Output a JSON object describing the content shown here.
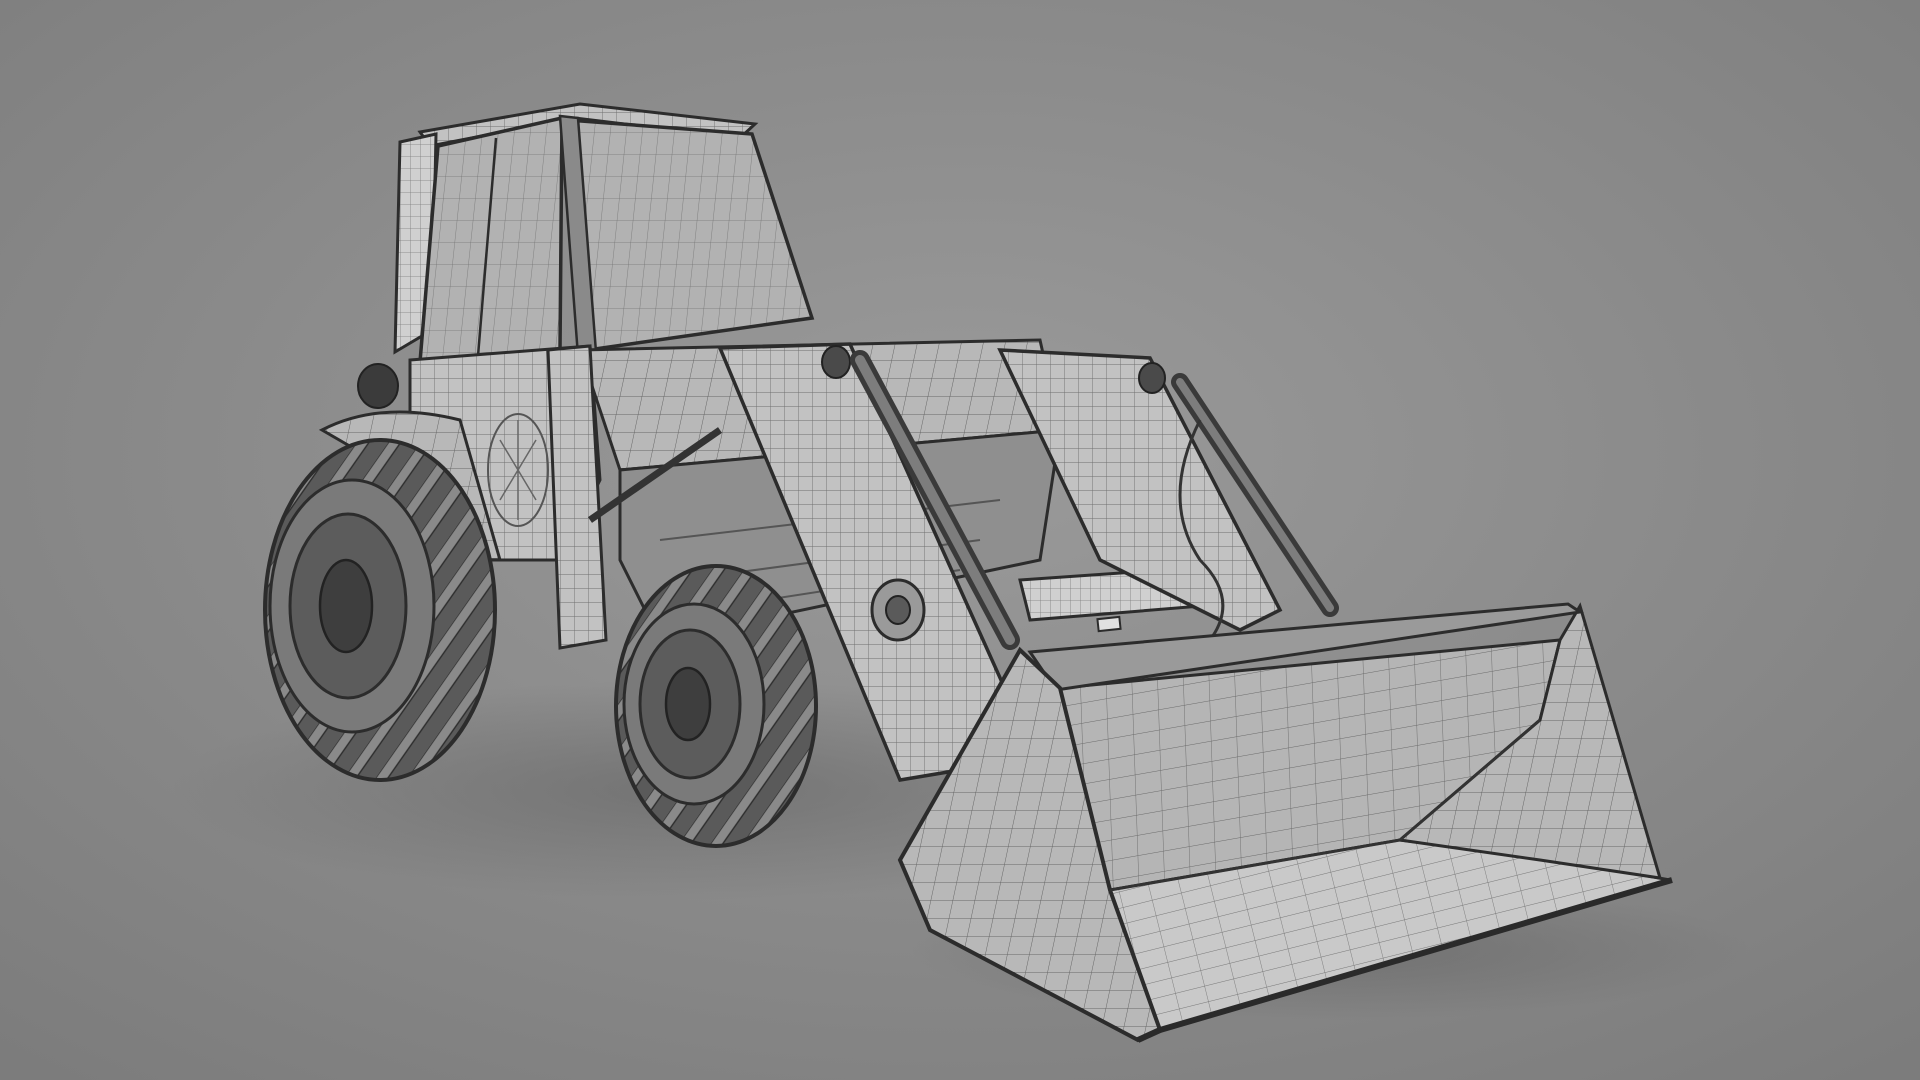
{
  "scene": {
    "subject": "tractor-front-loader-wireframe",
    "render_style": "gray-clay-wireframe"
  },
  "colors": {
    "background_light": "#9a9a9a",
    "background_dark": "#7c7c7c",
    "floor": "#8e8e8e",
    "surface_light": "#c4c4c4",
    "surface_mid": "#a9a9a9",
    "surface_dark": "#7a7a7a",
    "tire": "#5a5a5a",
    "tire_dark": "#3b3b3b",
    "edge_line": "#2c2c2c",
    "mesh_line": "#6e6e6e",
    "shadow": "#6f6f6f"
  }
}
